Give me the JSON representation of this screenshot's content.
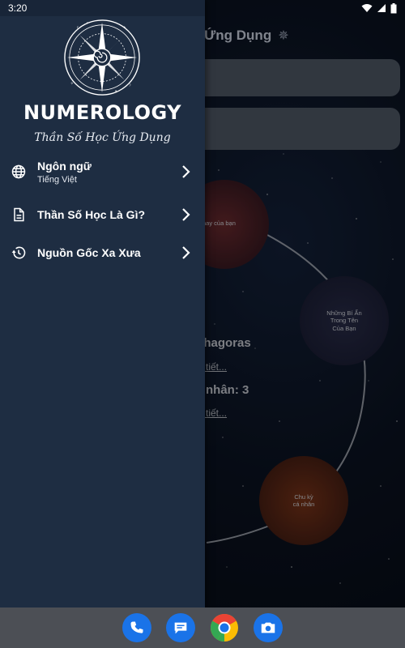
{
  "status_bar": {
    "time": "3:20"
  },
  "background_app": {
    "title_fragment": "c Ứng Dụng",
    "section_heading_1": "ythagoras",
    "link_1": "i tiết...",
    "section_heading_2": "nhân: 3",
    "link_2": "i tiết...",
    "bubbles": [
      {
        "label": "nay của bạn"
      },
      {
        "label_lines": [
          "Những Bí Ẩn",
          "Trong Tên",
          "Của Bạn"
        ]
      },
      {
        "label_lines": [
          "Chu kỳ",
          "cá nhân"
        ]
      }
    ]
  },
  "drawer": {
    "brand_title": "NUMEROLOGY",
    "brand_subtitle": "Thần Số Học Ứng Dụng",
    "menu": [
      {
        "label": "Ngôn ngữ",
        "sublabel": "Tiếng Việt",
        "icon": "globe-icon"
      },
      {
        "label": "Thần Số Học Là Gì?",
        "icon": "document-icon"
      },
      {
        "label": "Nguồn Gốc Xa Xưa",
        "icon": "history-icon"
      }
    ]
  },
  "dock": {
    "apps": [
      {
        "name": "phone",
        "icon": "phone-icon",
        "color": "#1a73e8"
      },
      {
        "name": "messages",
        "icon": "messages-icon",
        "color": "#1a73e8"
      },
      {
        "name": "chrome",
        "icon": "chrome-icon",
        "color": "#ffffff"
      },
      {
        "name": "camera",
        "icon": "camera-icon",
        "color": "#1a73e8"
      }
    ]
  },
  "colors": {
    "drawer_bg": "#1e2d42",
    "dock_bg": "#4c4f55",
    "card_bg": "#4f5966"
  }
}
